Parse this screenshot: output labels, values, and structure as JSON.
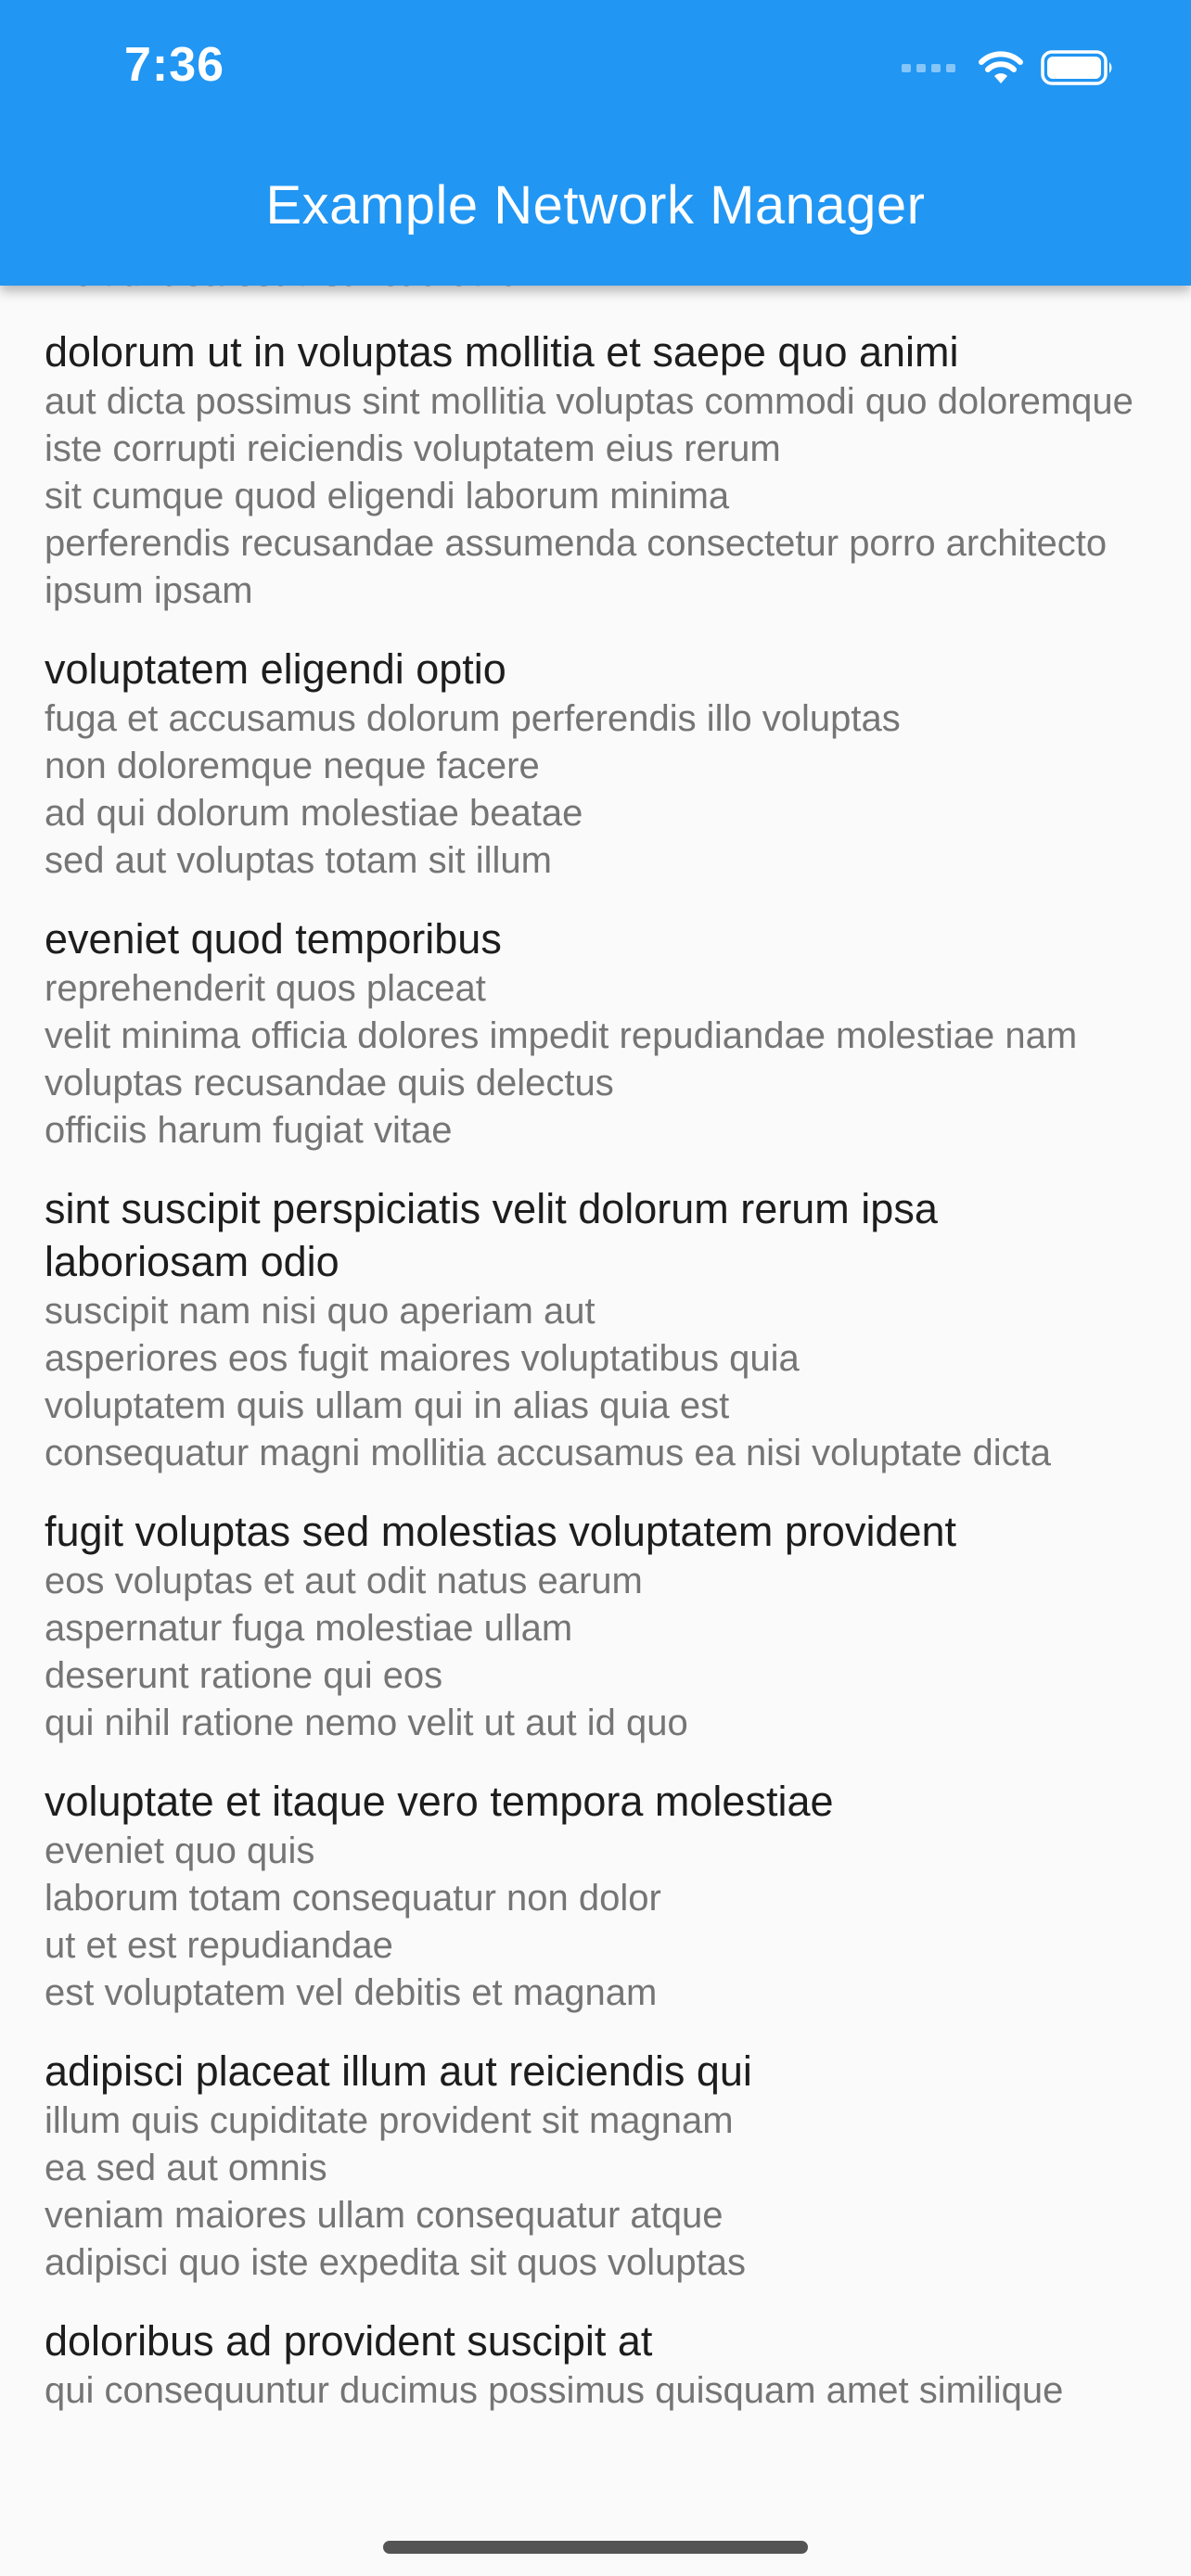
{
  "status_bar": {
    "time": "7:36"
  },
  "app_bar": {
    "title": "Example Network Manager",
    "color": "#2196f3"
  },
  "posts": [
    {
      "title": "",
      "body": "incidunt ea est distinctio odio"
    },
    {
      "title": "dolorum ut in voluptas mollitia et saepe quo animi",
      "body": "aut dicta possimus sint mollitia voluptas commodi quo doloremque\niste corrupti reiciendis voluptatem eius rerum\nsit cumque quod eligendi laborum minima\nperferendis recusandae assumenda consectetur porro architecto ipsum ipsam"
    },
    {
      "title": "voluptatem eligendi optio",
      "body": "fuga et accusamus dolorum perferendis illo voluptas\nnon doloremque neque facere\nad qui dolorum molestiae beatae\nsed aut voluptas totam sit illum"
    },
    {
      "title": "eveniet quod temporibus",
      "body": "reprehenderit quos placeat\nvelit minima officia dolores impedit repudiandae molestiae nam\nvoluptas recusandae quis delectus\nofficiis harum fugiat vitae"
    },
    {
      "title": "sint suscipit perspiciatis velit dolorum rerum ipsa laboriosam odio",
      "body": "suscipit nam nisi quo aperiam aut\nasperiores eos fugit maiores voluptatibus quia\nvoluptatem quis ullam qui in alias quia est\nconsequatur magni mollitia accusamus ea nisi voluptate dicta"
    },
    {
      "title": "fugit voluptas sed molestias voluptatem provident",
      "body": "eos voluptas et aut odit natus earum\naspernatur fuga molestiae ullam\ndeserunt ratione qui eos\nqui nihil ratione nemo velit ut aut id quo"
    },
    {
      "title": "voluptate et itaque vero tempora molestiae",
      "body": "eveniet quo quis\nlaborum totam consequatur non dolor\nut et est repudiandae\nest voluptatem vel debitis et magnam"
    },
    {
      "title": "adipisci placeat illum aut reiciendis qui",
      "body": "illum quis cupiditate provident sit magnam\nea sed aut omnis\nveniam maiores ullam consequatur atque\nadipisci quo iste expedita sit quos voluptas"
    },
    {
      "title": "doloribus ad provident suscipit at",
      "body": "qui consequuntur ducimus possimus quisquam amet similique"
    }
  ]
}
